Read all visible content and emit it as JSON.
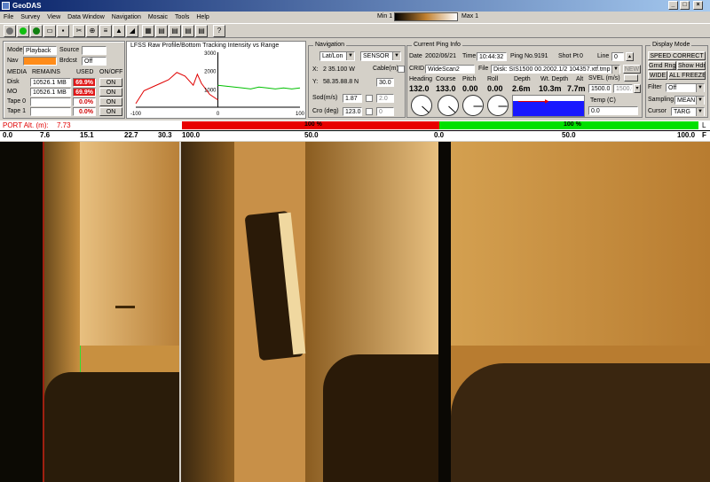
{
  "window": {
    "title": "GeoDAS"
  },
  "menu": [
    "File",
    "Survey",
    "View",
    "Data Window",
    "Navigation",
    "Mosaic",
    "Tools",
    "Help"
  ],
  "scale": {
    "min_label": "Min 1",
    "max_label": "Max 1"
  },
  "toolbar_icons": [
    "stop-icon",
    "record-icon",
    "play-icon",
    "open-folder-icon",
    "save-icon",
    "cut-icon",
    "anchor-icon",
    "layers-icon",
    "waveform-icon",
    "terrain-icon",
    "grid-icon",
    "print-icon",
    "print-icon",
    "print-icon",
    "help-icon"
  ],
  "media": {
    "mode_label": "Mode",
    "mode_value": "Playback",
    "source_label": "Source",
    "source_value": "",
    "nav_label": "Nav",
    "brcast_label": "Brdcst",
    "brcast_value": "Off",
    "headers": [
      "MEDIA",
      "REMAINS",
      "USED",
      "ON/OFF"
    ],
    "rows": [
      {
        "name": "Disk",
        "remains": "10526.1 MB",
        "used": "69.9%",
        "state": "ON"
      },
      {
        "name": "MO",
        "remains": "10526.1 MB",
        "used": "69.9%",
        "state": "ON"
      },
      {
        "name": "Tape 0",
        "remains": "",
        "used": "0.0%",
        "state": "ON"
      },
      {
        "name": "Tape 1",
        "remains": "",
        "used": "0.0%",
        "state": "ON"
      }
    ]
  },
  "profile_plot": {
    "title": "LFSS Raw Profile/Bottom Tracking Intensity vs Range",
    "y_ticks": [
      "3000",
      "2000",
      "1000"
    ],
    "x_ticks": [
      "-100",
      "0",
      "100"
    ]
  },
  "navigation": {
    "title": "Navigation",
    "coord_mode": "Lat/Lon",
    "source": "SENSOR",
    "x_label": "X:",
    "x_value": "2 35.100 W",
    "y_label": "Y:",
    "y_value": "58.35.88.8 N",
    "cable_label": "Cable(m)",
    "cable_value": "30.0",
    "sod_label": "Sod(m/s)",
    "sod_value": "1.87",
    "sod_set": "2.0",
    "cro_label": "Cro (deg)",
    "cro_value": "123.0",
    "cro_set": "0"
  },
  "ping": {
    "title": "Current Ping Info",
    "date_label": "Date",
    "date_value": "2002/06/21",
    "time_label": "Time",
    "time_value": "10:44:32",
    "ping_label": "Ping No.",
    "ping_value": "9191",
    "shot_label": "Shot Pt",
    "shot_value": "0",
    "line_label": "Line",
    "line_value": "0",
    "crid_label": "CRID",
    "crid_value": "WideScan2",
    "file_label": "File",
    "file_value": "Disk: SIS1500 00.2002.1/2 104357.xtf.tmp",
    "new_label": "NEW",
    "headers": [
      "Heading",
      "Course",
      "Pitch",
      "Roll",
      "Depth",
      "Wt. Depth",
      "Alt"
    ],
    "values": [
      "132.0",
      "133.0",
      "0.00",
      "0.00",
      "2.6m",
      "10.3m",
      "7.7m"
    ]
  },
  "svel": {
    "label": "SVEL (m/s)",
    "value": "1500.0",
    "value2": "1500.0",
    "temp_label": "Temp (C)",
    "temp_value": "0.0"
  },
  "display_mode": {
    "title": "Display Mode",
    "speed_correct": "SPEED CORRECT",
    "grnd_rng": "Grnd Rng",
    "show_hdr": "Show Hdr",
    "wide": "WIDE",
    "all_freeze": "ALL FREEZE",
    "filter_label": "Filter",
    "filter_value": "Off",
    "sampling_label": "Sampling",
    "sampling_value": "MEAN",
    "cursor_label": "Cursor",
    "cursor_value": "TARG"
  },
  "port_panel": {
    "label": "PORT Alt. (m):",
    "value": "7.73",
    "ticks": [
      "0.0",
      "7.6",
      "15.1",
      "22.7",
      "30.3"
    ]
  },
  "main_panel": {
    "port_pct": "100 %",
    "stbd_pct": "100 %",
    "ticks": [
      "100.0",
      "50.0",
      "0.0",
      "50.0",
      "100.0"
    ],
    "left_letter": "L",
    "right_letter": "F"
  },
  "colors": {
    "port_bar": "#e80000",
    "stbd_bar": "#00e000",
    "depth_fill": "#1818ff"
  },
  "chart_data": {
    "type": "line",
    "title": "LFSS Raw Profile/Bottom Tracking Intensity vs Range",
    "xlabel": "",
    "ylabel": "",
    "xlim": [
      -100,
      100
    ],
    "ylim": [
      0,
      3000
    ],
    "series": [
      {
        "color": "#e00000",
        "x": [
          -100,
          -90,
          -80,
          -70,
          -60,
          -50,
          -40,
          -30,
          -25,
          -20,
          -10,
          0
        ],
        "y": [
          200,
          900,
          1100,
          1300,
          1500,
          1900,
          1700,
          1200,
          1800,
          1300,
          700,
          400
        ]
      },
      {
        "color": "#00c000",
        "x": [
          0,
          10,
          20,
          30,
          40,
          50,
          60,
          70,
          80,
          90,
          100
        ],
        "y": [
          1200,
          1150,
          1100,
          1050,
          1000,
          1100,
          1050,
          1000,
          1050,
          1000,
          1050
        ]
      }
    ]
  }
}
